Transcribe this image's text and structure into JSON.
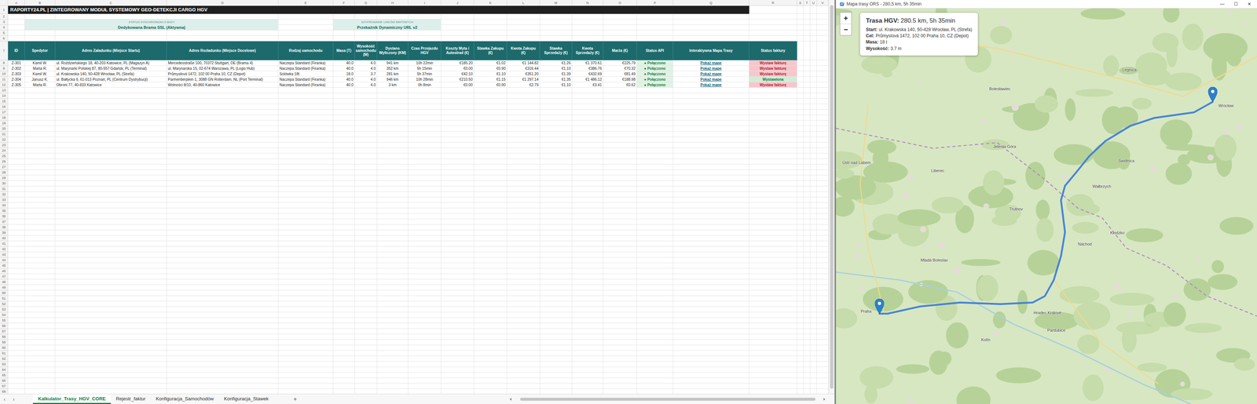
{
  "excel": {
    "column_letters": [
      "A",
      "B",
      "C",
      "D",
      "E",
      "F",
      "G",
      "H",
      "I",
      "J",
      "K",
      "L",
      "M",
      "N",
      "O",
      "P",
      "Q",
      "R",
      "S",
      "T",
      "U",
      "V"
    ],
    "row_numbers": [
      "1",
      "2",
      "3",
      "4",
      "5",
      "6",
      "7",
      "8",
      "9",
      "10",
      "11",
      "12",
      "13",
      "14",
      "15",
      "16",
      "17",
      "18",
      "19",
      "20",
      "21",
      "22",
      "23",
      "24",
      "25",
      "26",
      "27",
      "28",
      "29",
      "30",
      "31",
      "32",
      "33",
      "34",
      "35",
      "36",
      "37",
      "38",
      "39",
      "40",
      "41",
      "42",
      "43",
      "44",
      "45",
      "46",
      "47",
      "48",
      "49",
      "50",
      "51",
      "52",
      "53",
      "54",
      "55",
      "56",
      "57",
      "58",
      "59",
      "60",
      "61",
      "62",
      "63",
      "64",
      "65",
      "66",
      "67",
      "68"
    ],
    "title": "RAPORTY24.PL  |  ZINTEGROWANY MODUŁ SYSTEMOWY GEO-DETEKCJI CARGO HGV",
    "status_boxes": [
      {
        "label": "STATUS SYNCHRONIZACJI BAZY",
        "value": "Dedykowana Brama SSL (Aktywna)"
      },
      {
        "label": "SZYFROWANIE LINKÓW MAPOWYCH",
        "value": "Przekaźnik Dynamiczny URL v2"
      }
    ],
    "table": {
      "columns": [
        "ID",
        "Spedytor",
        "Adres Załadunku (Miejsce Startu)",
        "Adres Rozładunku (Miejsce Docelowe)",
        "Rodzaj samochodu",
        "Masa (T)",
        "Wysokość samochodu (M)",
        "Dystans Wyliczony (KM)",
        "Czas Przejazdu HGV",
        "Koszty Myta i Autostrad (€)",
        "Stawka Zakupu (€)",
        "Kwota Zakupu (€)",
        "Stawka Sprzedaży (€)",
        "Kwota Sprzedaży (€)",
        "Marża (€)",
        "Status API",
        "Interaktywna Mapa Trasy",
        "Status faktury"
      ],
      "rows": [
        {
          "cells": [
            "Z-301",
            "Kamil W.",
            "ul. Roździeńskiego 18, 40-203 Katowice, PL (Magazyn A)",
            "Mercedesstraße 100, 70372 Stuttgart, DE (Brama 4)",
            "Naczepa Standard (Firanka)",
            "40.0",
            "4.0",
            "941 km",
            "10h 22min",
            "€185.20",
            "€1.02",
            "€1 144.82",
            "€1.26",
            "€1 370.61",
            "€225.79"
          ],
          "api_status": "● Połączono",
          "map_link": "Pokaż mapę",
          "invoice": {
            "text": "Wystaw fakturę",
            "issued": false
          }
        },
        {
          "cells": [
            "Z-302",
            "Marta R.",
            "ul. Marynarki Polskiej 87, 80-557 Gdańsk, PL (Terminal)",
            "ul. Marynarska 15, 02-674 Warszawa, PL (Logis Hub)",
            "Naczepa Standard (Firanka)",
            "40.0",
            "4.0",
            "352 km",
            "5h 15min",
            "€0.00",
            "€0.90",
            "€316.44",
            "€1.10",
            "€386.76",
            "€70.32"
          ],
          "api_status": "● Połączono",
          "map_link": "Pokaż mapę",
          "invoice": {
            "text": "Wystaw fakturę",
            "issued": false
          }
        },
        {
          "cells": [
            "Z-303",
            "Kamil W.",
            "ul. Krakowska 140, 50-428 Wrocław, PL (Strefa)",
            "Průmyslová 1472, 102 00 Praha 10, CZ (Depot)",
            "Solówka 18t",
            "18.0",
            "3.7",
            "281 km",
            "5h 37min",
            "€42.10",
            "€1.10",
            "€351.20",
            "€1.39",
            "€432.69",
            "€81.49"
          ],
          "api_status": "● Połączono",
          "map_link": "Pokaż mapę",
          "invoice": {
            "text": "Wystaw fakturę",
            "issued": false
          }
        },
        {
          "cells": [
            "Z-304",
            "Janusz K.",
            "ul. Bałtycka 6, 61-013 Poznań, PL (Centrum Dystrybucji)",
            "Parmentierplein 1, 3088 GN Rotterdam, NL (Port Terminal)",
            "Naczepa Standard (Firanka)",
            "40.0",
            "4.0",
            "946 km",
            "10h 28min",
            "€210.50",
            "€1.15",
            "€1 297.14",
            "€1.35",
            "€1 486.12",
            "€188.98"
          ],
          "api_status": "● Połączono",
          "map_link": "Pokaż mapę",
          "invoice": {
            "text": "Wystawiona",
            "issued": true
          }
        },
        {
          "cells": [
            "Z-305",
            "Marta R.",
            "Obroni 77, 40-833 Katowice",
            "Wolności 8/10, 40-860 Katowice",
            "Naczepa Standard (Firanka)",
            "40.0",
            "4.0",
            "3 km",
            "0h 8min",
            "€0.00",
            "€0.90",
            "€2.79",
            "€1.10",
            "€3.41",
            "€0.62"
          ],
          "api_status": "● Połączono",
          "map_link": "Pokaż mapę",
          "invoice": {
            "text": "Wystaw fakturę",
            "issued": false
          }
        }
      ]
    },
    "nav": [
      "‹",
      "›"
    ],
    "sheet_tabs": [
      {
        "label": "Kalkulator_Trasy_HGV_CORE",
        "selected": true
      },
      {
        "label": "Rejestr_faktur",
        "selected": false
      },
      {
        "label": "Konfiguracja_Samochodów",
        "selected": false
      },
      {
        "label": "Konfiguracja_Stawek",
        "selected": false
      }
    ],
    "add_sheet": "+"
  },
  "map_window": {
    "title": "Mapa trasy ORS - 280,5 km, 5h 35min",
    "window_controls": [
      "—",
      "☐",
      "✕"
    ],
    "zoom": [
      "+",
      "−"
    ],
    "info": {
      "title_label": "Trasa HGV:",
      "title_value": "280.5 km, 5h 35min",
      "lines": [
        {
          "label": "Start:",
          "value": "ul. Krakowska 140, 50-428 Wrocław, PL (Strefa)"
        },
        {
          "label": "Cel:",
          "value": "Průmyslová 1472, 102 00 Praha 10, CZ (Depot)"
        },
        {
          "label": "Masa:",
          "value": "18 t"
        },
        {
          "label": "Wysokość:",
          "value": "3.7 m"
        }
      ]
    },
    "labels": [
      "Wrocław",
      "Praha",
      "Bolesławiec",
      "Legnica",
      "Jelenia Góra",
      "Liberec",
      "Wałbrzych",
      "Świdnica",
      "Kłodzko",
      "Trutnov",
      "Náchod",
      "Mladá Boleslav",
      "Ústí nad Labem",
      "Hradec Králové",
      "Pardubice",
      "Kolín"
    ]
  }
}
